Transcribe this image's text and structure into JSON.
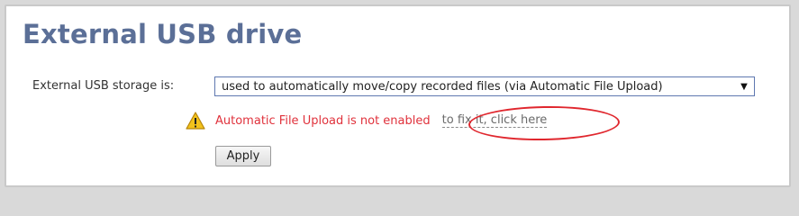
{
  "section": {
    "title": "External USB drive"
  },
  "storage": {
    "label": "External USB storage is:",
    "selected_value": "used to automatically move/copy recorded files (via Automatic File Upload)",
    "dropdown_arrow": "▼"
  },
  "warning": {
    "icon": "warning-triangle-icon",
    "message": "Automatic File Upload is not enabled",
    "fix_link": "to fix it, click here",
    "message_color": "#e0323c",
    "annotation_color": "#e0272e"
  },
  "actions": {
    "apply_label": "Apply"
  },
  "colors": {
    "title": "#5b6f97",
    "select_border": "#5f78b0",
    "warning_icon": "#f2c21b"
  }
}
